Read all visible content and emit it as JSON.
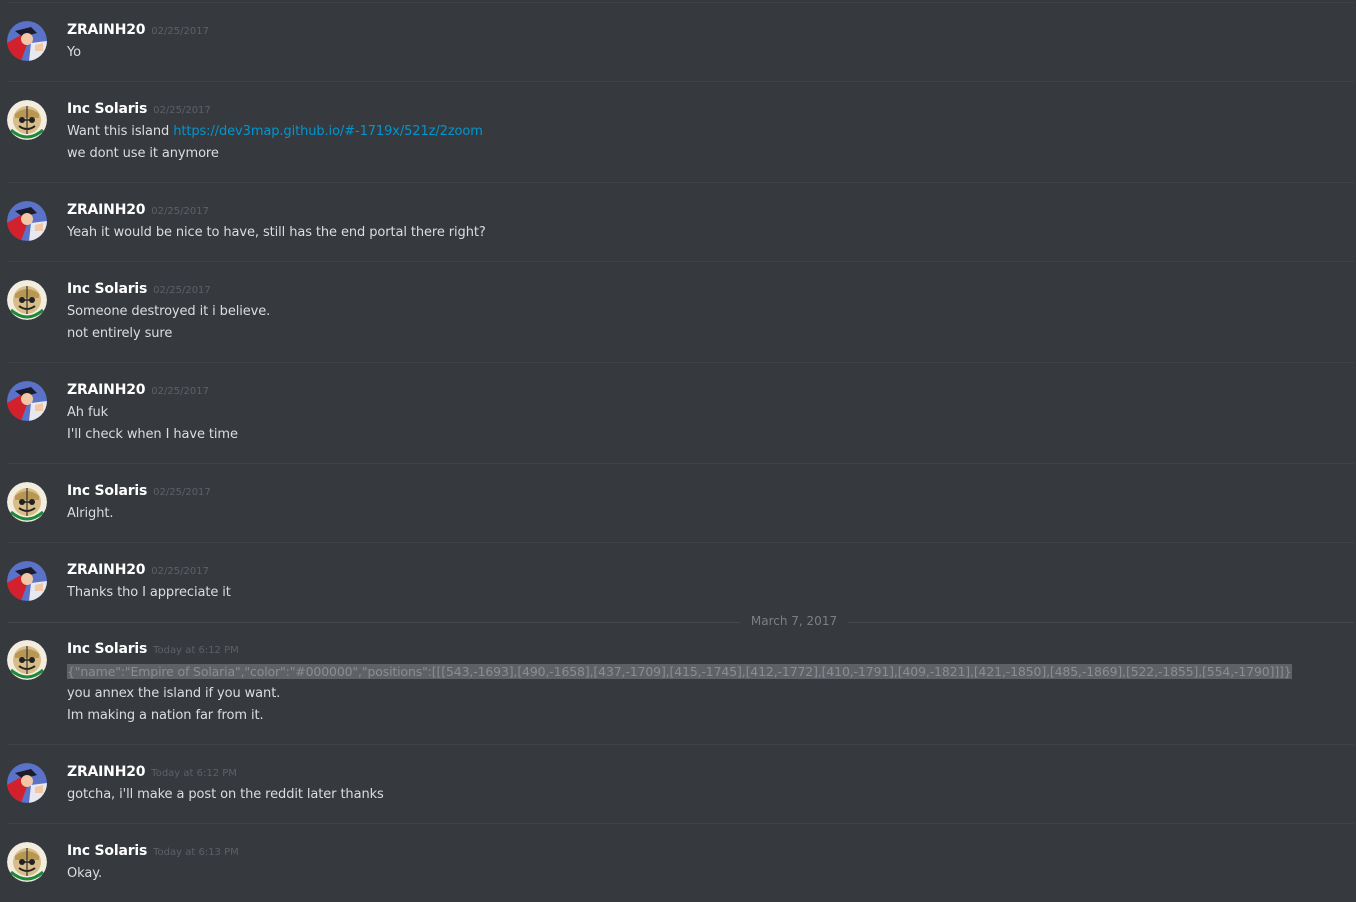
{
  "messages": [
    {
      "author": "ZRAINH20",
      "avatar": "zrain-avatar",
      "timestamp": "02/25/2017",
      "lines": [
        "Yo"
      ]
    },
    {
      "author": "Inc Solaris",
      "avatar": "solaris-avatar",
      "timestamp": "02/25/2017",
      "lines": [
        "Want this island ",
        "we dont use it anymore"
      ],
      "link": "https://dev3map.github.io/#-1719x/521z/2zoom"
    },
    {
      "author": "ZRAINH20",
      "avatar": "zrain-avatar",
      "timestamp": "02/25/2017",
      "lines": [
        "Yeah it would be nice to have, still has the end portal there right?"
      ]
    },
    {
      "author": "Inc Solaris",
      "avatar": "solaris-avatar",
      "timestamp": "02/25/2017",
      "lines": [
        "Someone destroyed it i believe.",
        "not entirely sure"
      ]
    },
    {
      "author": "ZRAINH20",
      "avatar": "zrain-avatar",
      "timestamp": "02/25/2017",
      "lines": [
        "Ah fuk",
        "I'll check when I have time"
      ]
    },
    {
      "author": "Inc Solaris",
      "avatar": "solaris-avatar",
      "timestamp": "02/25/2017",
      "lines": [
        "Alright."
      ]
    },
    {
      "author": "ZRAINH20",
      "avatar": "zrain-avatar",
      "timestamp": "02/25/2017",
      "lines": [
        "Thanks tho I appreciate it"
      ]
    },
    {
      "author": "Inc Solaris",
      "avatar": "solaris-avatar",
      "timestamp": "Today at 6:12 PM",
      "lines": [
        "{\"name\":\"Empire of Solaria\",\"color\":\"#000000\",\"positions\":[[[543,-1693],[490,-1658],[437,-1709],[415,-1745],[412,-1772],[410,-1791],[409,-1821],[421,-1850],[485,-1869],[522,-1855],[554,-1790]]]}",
        "you annex the island if you want.",
        "Im making a nation far from it."
      ]
    },
    {
      "author": "ZRAINH20",
      "avatar": "zrain-avatar",
      "timestamp": "Today at 6:12 PM",
      "lines": [
        "gotcha, i'll make a post on the reddit later thanks"
      ]
    },
    {
      "author": "Inc Solaris",
      "avatar": "solaris-avatar",
      "timestamp": "Today at 6:13 PM",
      "lines": [
        "Okay."
      ]
    }
  ],
  "date_separator": "March 7, 2017",
  "colors": {
    "background": "#36393e",
    "divider": "#3f4247",
    "username": "#ffffff",
    "timestamp": "#5d6066",
    "text": "#dcddde",
    "link": "#0096cf",
    "selection": "#5e6166"
  }
}
